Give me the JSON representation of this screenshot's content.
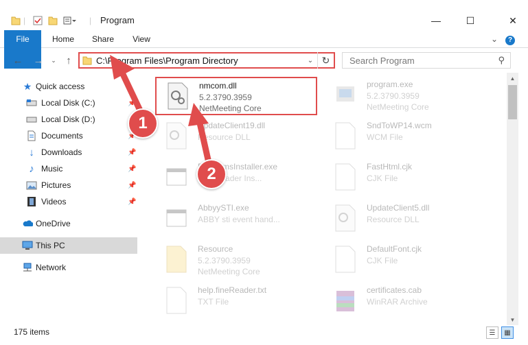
{
  "window": {
    "title": "Program",
    "minimize": "—",
    "maximize": "☐",
    "close": "✕"
  },
  "ribbon": {
    "tabs": [
      "File",
      "Home",
      "Share",
      "View"
    ],
    "help": "?"
  },
  "address": {
    "path": "C:\\Program Files\\Program Directory",
    "search_placeholder": "Search Program"
  },
  "nav": {
    "quick_access": "Quick access",
    "items": [
      "Local Disk (C:)",
      "Local Disk (D:)",
      "Documents",
      "Downloads",
      "Music",
      "Pictures",
      "Videos"
    ],
    "onedrive": "OneDrive",
    "this_pc": "This PC",
    "network": "Network"
  },
  "files": [
    {
      "name": "nmcom.dll",
      "line1": "5.2.3790.3959",
      "line2": "NetMeeting Core",
      "icon": "dll-gear-icon"
    },
    {
      "name": "program.exe",
      "line1": "5.2.3790.3959",
      "line2": "NetMeeting Core",
      "icon": "exe-icon"
    },
    {
      "name": "UpdateClient19.dll",
      "line1": "Resource DLL",
      "line2": "",
      "icon": "dll-gear-icon"
    },
    {
      "name": "SndToWP14.wcm",
      "line1": "WCM File",
      "line2": "",
      "icon": "blank-file-icon"
    },
    {
      "name": "ProgramsInstaller.exe",
      "line1": "Downloader Ins...",
      "line2": "",
      "icon": "exe-window-icon"
    },
    {
      "name": "FastHtml.cjk",
      "line1": "CJK File",
      "line2": "",
      "icon": "blank-file-icon"
    },
    {
      "name": "AbbyySTI.exe",
      "line1": "ABBY sti event hand...",
      "line2": "",
      "icon": "exe-window-icon"
    },
    {
      "name": "UpdateClient5.dll",
      "line1": "Resource DLL",
      "line2": "",
      "icon": "dll-gear-icon"
    },
    {
      "name": "Resource",
      "line1": "5.2.3790.3959",
      "line2": "NetMeeting Core",
      "icon": "folder-file-icon"
    },
    {
      "name": "DefaultFont.cjk",
      "line1": "CJK File",
      "line2": "",
      "icon": "blank-file-icon"
    },
    {
      "name": "help.fineReader.txt",
      "line1": "TXT File",
      "line2": "",
      "icon": "blank-file-icon"
    },
    {
      "name": "certificates.cab",
      "line1": "WinRAR Archive",
      "line2": "",
      "icon": "winrar-icon"
    }
  ],
  "status": {
    "count": "175 items"
  },
  "callouts": [
    "1",
    "2"
  ],
  "colors": {
    "accent": "#1979ca",
    "highlight": "#e04c4c"
  }
}
